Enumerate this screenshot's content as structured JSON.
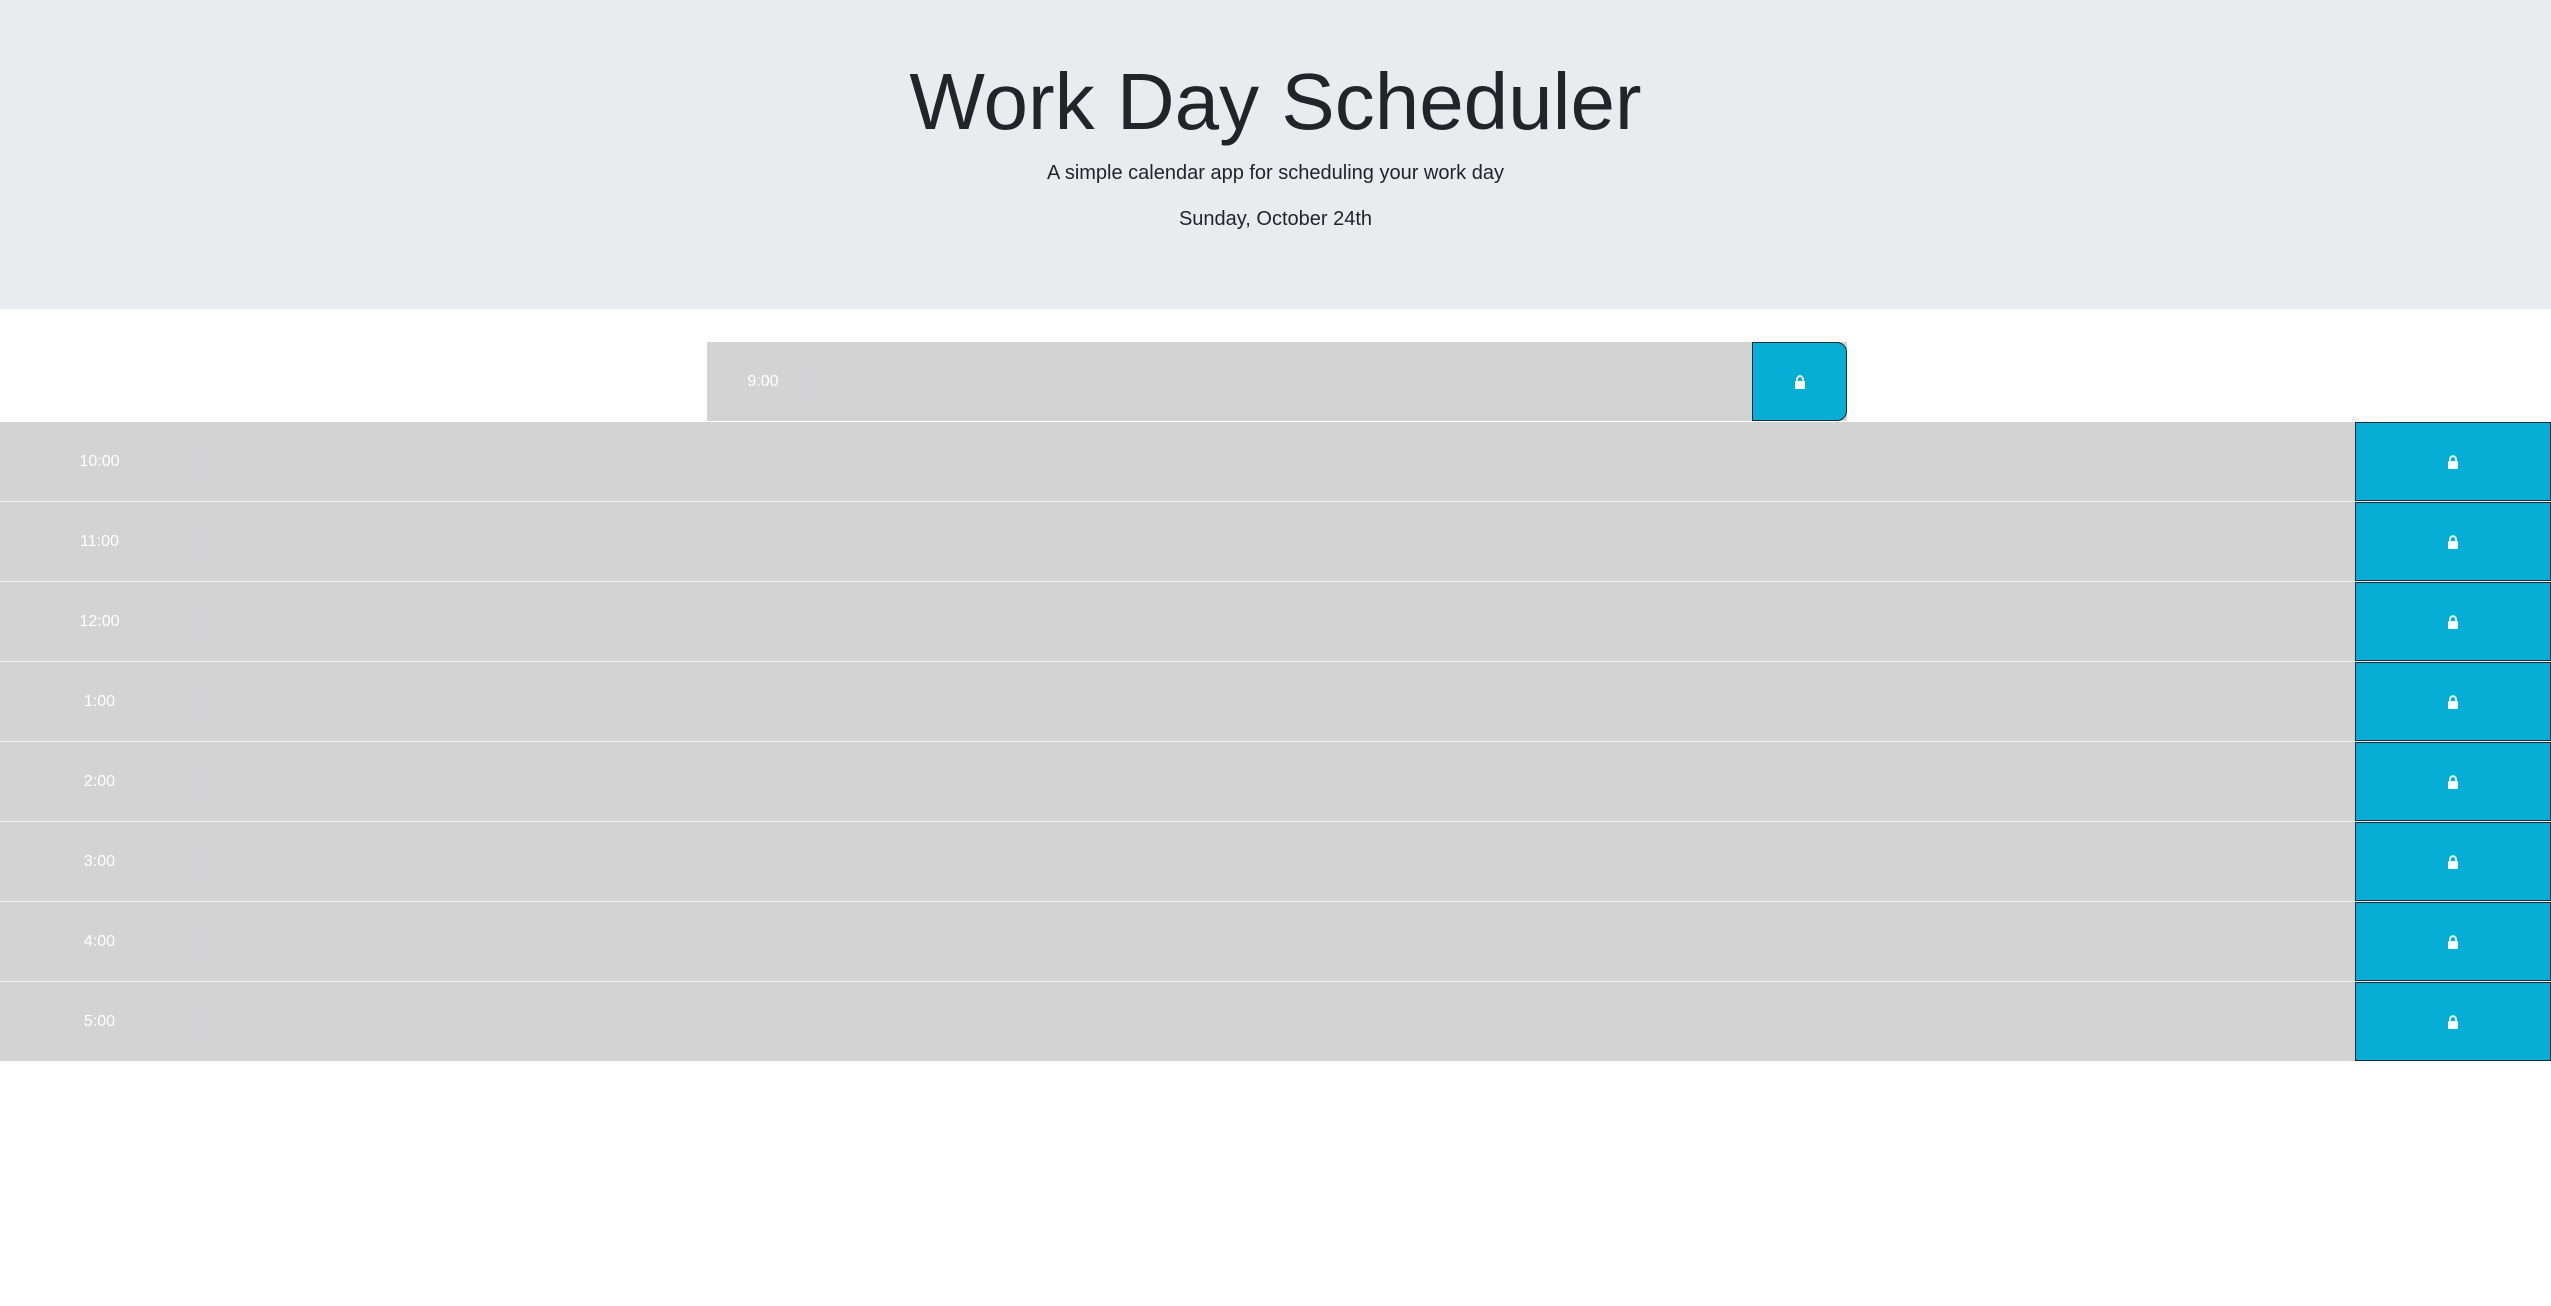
{
  "header": {
    "title": "Work Day Scheduler",
    "subtitle": "A simple calendar app for scheduling your work day",
    "current_date": "Sunday, October 24th"
  },
  "timeblocks": [
    {
      "hour": "9:00",
      "text": "",
      "save_icon": "lock-icon"
    },
    {
      "hour": "10:00",
      "text": "",
      "save_icon": "lock-icon"
    },
    {
      "hour": "11:00",
      "text": "",
      "save_icon": "lock-icon"
    },
    {
      "hour": "12:00",
      "text": "",
      "save_icon": "lock-icon"
    },
    {
      "hour": "1:00",
      "text": "",
      "save_icon": "lock-icon"
    },
    {
      "hour": "2:00",
      "text": "",
      "save_icon": "lock-icon"
    },
    {
      "hour": "3:00",
      "text": "",
      "save_icon": "lock-icon"
    },
    {
      "hour": "4:00",
      "text": "",
      "save_icon": "lock-icon"
    },
    {
      "hour": "5:00",
      "text": "",
      "save_icon": "lock-icon"
    }
  ],
  "colors": {
    "header_bg": "#e9ecef",
    "block_bg": "#d3d3d3",
    "save_button": "#06aed5",
    "hour_text": "#ffffff"
  }
}
